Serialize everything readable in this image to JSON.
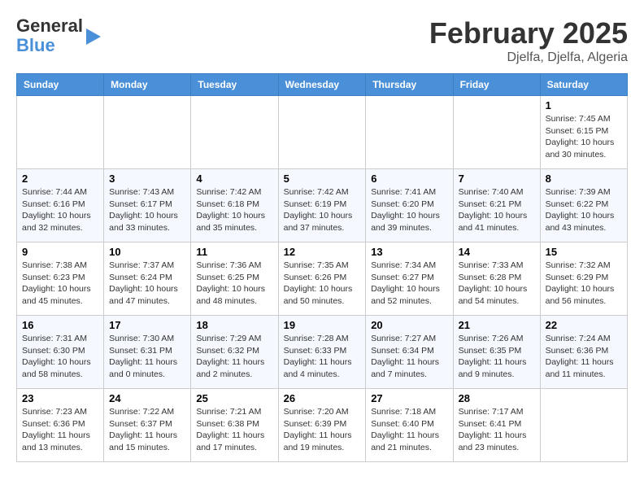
{
  "header": {
    "logo_line1": "General",
    "logo_line2": "Blue",
    "month": "February 2025",
    "location": "Djelfa, Djelfa, Algeria"
  },
  "weekdays": [
    "Sunday",
    "Monday",
    "Tuesday",
    "Wednesday",
    "Thursday",
    "Friday",
    "Saturday"
  ],
  "weeks": [
    [
      {
        "day": "",
        "info": ""
      },
      {
        "day": "",
        "info": ""
      },
      {
        "day": "",
        "info": ""
      },
      {
        "day": "",
        "info": ""
      },
      {
        "day": "",
        "info": ""
      },
      {
        "day": "",
        "info": ""
      },
      {
        "day": "1",
        "info": "Sunrise: 7:45 AM\nSunset: 6:15 PM\nDaylight: 10 hours and 30 minutes."
      }
    ],
    [
      {
        "day": "2",
        "info": "Sunrise: 7:44 AM\nSunset: 6:16 PM\nDaylight: 10 hours and 32 minutes."
      },
      {
        "day": "3",
        "info": "Sunrise: 7:43 AM\nSunset: 6:17 PM\nDaylight: 10 hours and 33 minutes."
      },
      {
        "day": "4",
        "info": "Sunrise: 7:42 AM\nSunset: 6:18 PM\nDaylight: 10 hours and 35 minutes."
      },
      {
        "day": "5",
        "info": "Sunrise: 7:42 AM\nSunset: 6:19 PM\nDaylight: 10 hours and 37 minutes."
      },
      {
        "day": "6",
        "info": "Sunrise: 7:41 AM\nSunset: 6:20 PM\nDaylight: 10 hours and 39 minutes."
      },
      {
        "day": "7",
        "info": "Sunrise: 7:40 AM\nSunset: 6:21 PM\nDaylight: 10 hours and 41 minutes."
      },
      {
        "day": "8",
        "info": "Sunrise: 7:39 AM\nSunset: 6:22 PM\nDaylight: 10 hours and 43 minutes."
      }
    ],
    [
      {
        "day": "9",
        "info": "Sunrise: 7:38 AM\nSunset: 6:23 PM\nDaylight: 10 hours and 45 minutes."
      },
      {
        "day": "10",
        "info": "Sunrise: 7:37 AM\nSunset: 6:24 PM\nDaylight: 10 hours and 47 minutes."
      },
      {
        "day": "11",
        "info": "Sunrise: 7:36 AM\nSunset: 6:25 PM\nDaylight: 10 hours and 48 minutes."
      },
      {
        "day": "12",
        "info": "Sunrise: 7:35 AM\nSunset: 6:26 PM\nDaylight: 10 hours and 50 minutes."
      },
      {
        "day": "13",
        "info": "Sunrise: 7:34 AM\nSunset: 6:27 PM\nDaylight: 10 hours and 52 minutes."
      },
      {
        "day": "14",
        "info": "Sunrise: 7:33 AM\nSunset: 6:28 PM\nDaylight: 10 hours and 54 minutes."
      },
      {
        "day": "15",
        "info": "Sunrise: 7:32 AM\nSunset: 6:29 PM\nDaylight: 10 hours and 56 minutes."
      }
    ],
    [
      {
        "day": "16",
        "info": "Sunrise: 7:31 AM\nSunset: 6:30 PM\nDaylight: 10 hours and 58 minutes."
      },
      {
        "day": "17",
        "info": "Sunrise: 7:30 AM\nSunset: 6:31 PM\nDaylight: 11 hours and 0 minutes."
      },
      {
        "day": "18",
        "info": "Sunrise: 7:29 AM\nSunset: 6:32 PM\nDaylight: 11 hours and 2 minutes."
      },
      {
        "day": "19",
        "info": "Sunrise: 7:28 AM\nSunset: 6:33 PM\nDaylight: 11 hours and 4 minutes."
      },
      {
        "day": "20",
        "info": "Sunrise: 7:27 AM\nSunset: 6:34 PM\nDaylight: 11 hours and 7 minutes."
      },
      {
        "day": "21",
        "info": "Sunrise: 7:26 AM\nSunset: 6:35 PM\nDaylight: 11 hours and 9 minutes."
      },
      {
        "day": "22",
        "info": "Sunrise: 7:24 AM\nSunset: 6:36 PM\nDaylight: 11 hours and 11 minutes."
      }
    ],
    [
      {
        "day": "23",
        "info": "Sunrise: 7:23 AM\nSunset: 6:36 PM\nDaylight: 11 hours and 13 minutes."
      },
      {
        "day": "24",
        "info": "Sunrise: 7:22 AM\nSunset: 6:37 PM\nDaylight: 11 hours and 15 minutes."
      },
      {
        "day": "25",
        "info": "Sunrise: 7:21 AM\nSunset: 6:38 PM\nDaylight: 11 hours and 17 minutes."
      },
      {
        "day": "26",
        "info": "Sunrise: 7:20 AM\nSunset: 6:39 PM\nDaylight: 11 hours and 19 minutes."
      },
      {
        "day": "27",
        "info": "Sunrise: 7:18 AM\nSunset: 6:40 PM\nDaylight: 11 hours and 21 minutes."
      },
      {
        "day": "28",
        "info": "Sunrise: 7:17 AM\nSunset: 6:41 PM\nDaylight: 11 hours and 23 minutes."
      },
      {
        "day": "",
        "info": ""
      }
    ]
  ]
}
